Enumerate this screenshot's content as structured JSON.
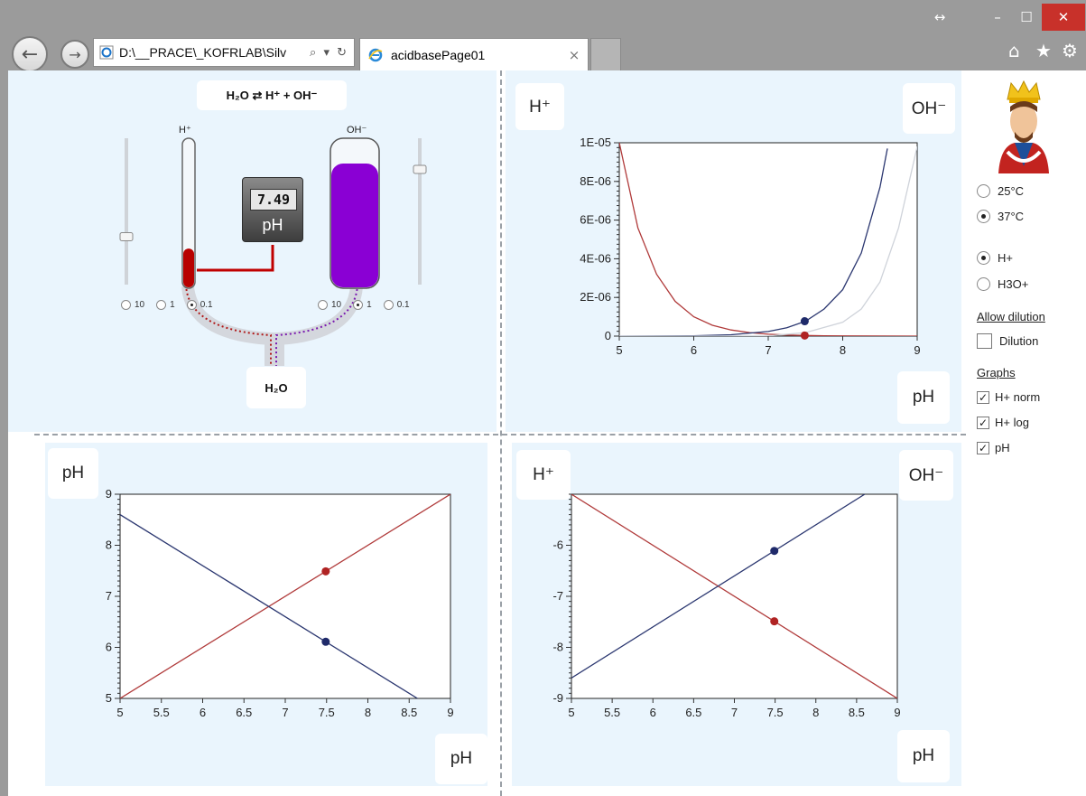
{
  "browser": {
    "address": "D:\\__PRACE\\_KOFRLAB\\Silv",
    "tab_title": "acidbasePage01",
    "tab_close": "×",
    "back": "←",
    "forward": "→",
    "search_refresh": "⌕ ▾ ↻",
    "restore": "↔",
    "minimize": "–",
    "maximize": "☐",
    "close": "✕",
    "home": "⌂",
    "favorites": "★",
    "settings": "⚙"
  },
  "beaker": {
    "equation": "H₂O ⇄ H⁺ + OH⁻",
    "water": "H₂O",
    "acid_label": "H⁺",
    "base_label": "OH⁻",
    "ph_value": "7.49",
    "ph_unit": "pH",
    "acid_radios": [
      {
        "label": "10",
        "selected": false
      },
      {
        "label": "1",
        "selected": false
      },
      {
        "label": "0.1",
        "selected": true
      }
    ],
    "base_radios": [
      {
        "label": "10",
        "selected": false
      },
      {
        "label": "1",
        "selected": true
      },
      {
        "label": "0.1",
        "selected": false
      }
    ],
    "acid_level": 0.26,
    "base_level": 0.83,
    "acid_slider": 0.67,
    "base_slider": 0.21,
    "colors": {
      "acid": "#b80000",
      "base": "#8a00d4",
      "pipe": "#c00000"
    }
  },
  "sidebar": {
    "temperature": [
      {
        "label": "25°C",
        "selected": false
      },
      {
        "label": "37°C",
        "selected": true
      }
    ],
    "species": [
      {
        "label": "H+",
        "selected": true
      },
      {
        "label": "H3O+",
        "selected": false
      }
    ],
    "dilution_heading": "Allow dilution",
    "dilution": {
      "label": "Dilution",
      "checked": false
    },
    "graphs_heading": "Graphs",
    "graphs": [
      {
        "label": "H+ norm",
        "checked": true
      },
      {
        "label": "H+ log",
        "checked": true
      },
      {
        "label": "pH",
        "checked": true
      }
    ]
  },
  "chart_labels": {
    "top_left_corner": "H⁺",
    "top_right_corner": "OH⁻",
    "top_bottom_corner": "pH",
    "ph_left_corner": "pH",
    "ph_bottom_corner": "pH",
    "log_left_corner": "H⁺",
    "log_right_corner": "OH⁻",
    "log_bottom_corner": "pH"
  },
  "chart_data": [
    {
      "type": "line",
      "xlim": [
        5,
        9
      ],
      "ylim": [
        0,
        1e-05
      ],
      "xticks": [
        "5",
        "6",
        "7",
        "8",
        "9"
      ],
      "yticks": [
        "0",
        "2E-06",
        "4E-06",
        "6E-06",
        "8E-06",
        "1E-05"
      ],
      "series": [
        {
          "color": "#b03a3a",
          "x": [
            5,
            5.25,
            5.5,
            5.75,
            6,
            6.25,
            6.5,
            6.75,
            7,
            7.25,
            7.5,
            7.75,
            8,
            8.5,
            9
          ],
          "y": [
            1e-05,
            5.6e-06,
            3.2e-06,
            1.8e-06,
            1e-06,
            5.6e-07,
            3.2e-07,
            1.8e-07,
            1e-07,
            5.6e-08,
            3.2e-08,
            1.8e-08,
            1e-08,
            3e-09,
            1e-09
          ]
        },
        {
          "color": "#2b3770",
          "x": [
            5,
            6,
            6.5,
            7,
            7.25,
            7.5,
            7.75,
            8,
            8.25,
            8.5,
            8.6
          ],
          "y": [
            2e-09,
            2e-08,
            7e-08,
            2.4e-07,
            4.3e-07,
            7.7e-07,
            1.4e-06,
            2.4e-06,
            4.3e-06,
            7.7e-06,
            9.7e-06
          ]
        },
        {
          "color": "#cfd3da",
          "x": [
            5,
            6,
            7,
            7.5,
            8,
            8.25,
            8.5,
            8.75,
            9
          ],
          "y": [
            1e-10,
            1e-09,
            1e-08,
            1.8e-07,
            7.2e-07,
            1.4e-06,
            2.8e-06,
            5.6e-06,
            9.8e-06
          ]
        }
      ],
      "points": [
        {
          "x": 7.49,
          "y": 7.7e-07,
          "color": "#1f2a6a"
        },
        {
          "x": 7.49,
          "y": 3.2e-08,
          "color": "#b02323"
        }
      ]
    },
    {
      "type": "line",
      "xlim": [
        5,
        9
      ],
      "ylim": [
        5,
        9
      ],
      "xticks": [
        "5",
        "5.5",
        "6",
        "6.5",
        "7",
        "7.5",
        "8",
        "8.5",
        "9"
      ],
      "yticks": [
        "5",
        "6",
        "7",
        "8",
        "9"
      ],
      "series": [
        {
          "color": "#b03a3a",
          "x": [
            5,
            9
          ],
          "y": [
            5,
            9
          ]
        },
        {
          "color": "#2b3770",
          "x": [
            5,
            8.6
          ],
          "y": [
            8.6,
            5
          ]
        }
      ],
      "points": [
        {
          "x": 7.49,
          "y": 7.49,
          "color": "#b02323"
        },
        {
          "x": 7.49,
          "y": 6.11,
          "color": "#1f2a6a"
        }
      ]
    },
    {
      "type": "line",
      "xlim": [
        5,
        9
      ],
      "ylim": [
        -9,
        -5
      ],
      "xticks": [
        "5",
        "5.5",
        "6",
        "6.5",
        "7",
        "7.5",
        "8",
        "8.5",
        "9"
      ],
      "yticks": [
        "-9",
        "-8",
        "-7",
        "-6"
      ],
      "series": [
        {
          "color": "#b03a3a",
          "x": [
            5,
            9
          ],
          "y": [
            -5,
            -9
          ]
        },
        {
          "color": "#2b3770",
          "x": [
            5,
            8.6
          ],
          "y": [
            -8.6,
            -5
          ]
        }
      ],
      "points": [
        {
          "x": 7.49,
          "y": -6.11,
          "color": "#1f2a6a"
        },
        {
          "x": 7.49,
          "y": -7.49,
          "color": "#b02323"
        }
      ]
    }
  ]
}
